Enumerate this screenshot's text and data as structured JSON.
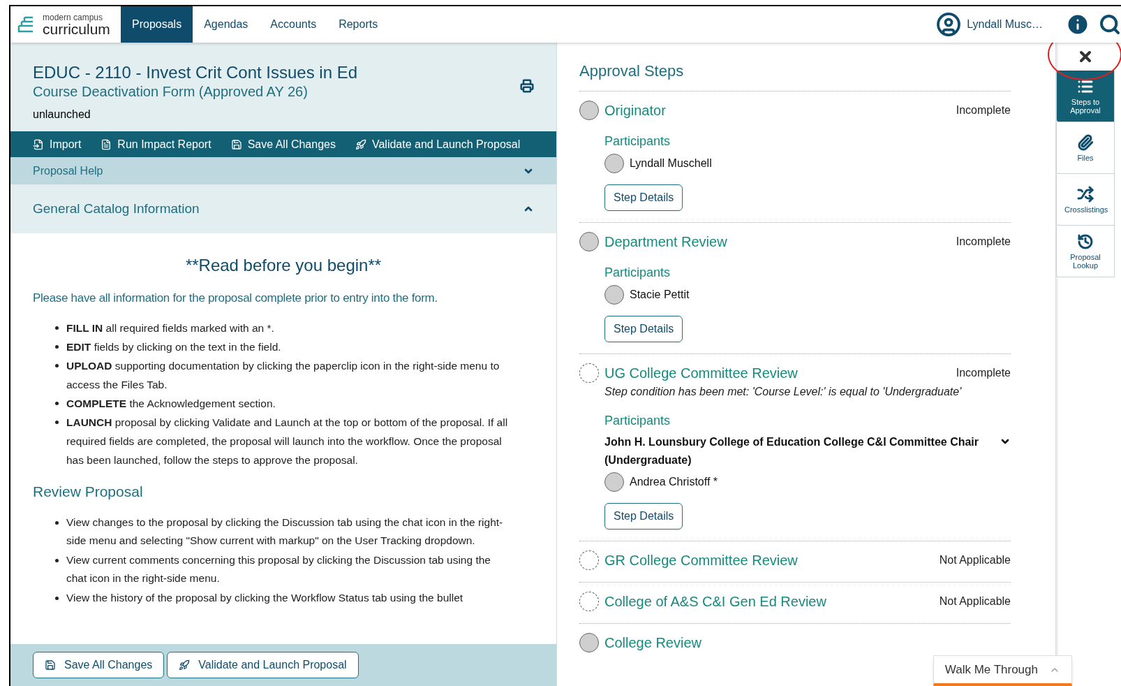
{
  "nav": {
    "logo_top": "modern campus",
    "logo_bottom": "curriculum",
    "tabs": [
      {
        "label": "Proposals",
        "selected": true
      },
      {
        "label": "Agendas",
        "selected": false
      },
      {
        "label": "Accounts",
        "selected": false
      },
      {
        "label": "Reports",
        "selected": false
      }
    ],
    "user": "Lyndall Musc…"
  },
  "proposal": {
    "title": "EDUC - 2110 - Invest Crit Cont Issues in Ed",
    "form": "Course Deactivation Form (Approved AY 26)",
    "status": "unlaunched"
  },
  "toolbar": [
    {
      "kind": "import",
      "label": "Import"
    },
    {
      "kind": "report",
      "label": "Run Impact Report"
    },
    {
      "kind": "save",
      "label": "Save All Changes"
    },
    {
      "kind": "launch",
      "label": "Validate and Launch Proposal"
    }
  ],
  "sections": [
    {
      "kind": "help",
      "label": "Proposal Help",
      "expanded": false
    },
    {
      "kind": "catalog",
      "label": "General Catalog Information",
      "expanded": true
    }
  ],
  "content": {
    "heading": "**Read before you begin**",
    "intro": "Please have all information for the proposal complete prior to entry into the form.",
    "bullets": [
      {
        "lead": "FILL IN",
        "text": "all required fields marked with an *."
      },
      {
        "lead": "EDIT",
        "text": "fields by clicking on the text in the field."
      },
      {
        "lead": "UPLOAD",
        "text": "supporting documentation by clicking the paperclip icon in the right-side menu to access the Files Tab."
      },
      {
        "lead": "COMPLETE",
        "text": "the Acknowledgement section."
      },
      {
        "lead": "LAUNCH",
        "text": "proposal by clicking Validate and Launch at the top or bottom of the proposal.  If all required fields are completed, the proposal will launch into the workflow. Once the proposal has been launched, follow the steps to approve the proposal."
      }
    ],
    "subheading": "Review Proposal",
    "review_bullets": [
      "View changes to the proposal by clicking the Discussion tab using the chat icon in the right-side menu and selecting \"Show current with markup\" on the User Tracking dropdown.",
      "View current comments concerning this proposal by clicking the Discussion tab using the chat icon in the right-side menu.",
      "View the history of the proposal by clicking the Workflow Status tab using the bullet"
    ]
  },
  "bottom_actions": [
    {
      "kind": "save",
      "label": "Save All Changes"
    },
    {
      "kind": "launch",
      "label": "Validate and Launch Proposal"
    }
  ],
  "approval": {
    "title": "Approval Steps",
    "steps": [
      {
        "name": "Originator",
        "status": "Incomplete",
        "kind": "active",
        "participants_label": "Participants",
        "people": [
          "Lyndall Muschell"
        ],
        "details": "Step Details"
      },
      {
        "name": "Department Review",
        "status": "Incomplete",
        "kind": "active",
        "participants_label": "Participants",
        "people": [
          "Stacie Pettit"
        ],
        "details": "Step Details"
      },
      {
        "name": "UG College Committee Review",
        "status": "Incomplete",
        "kind": "conditional",
        "condition": "Step condition has been met: 'Course Level:' is equal to 'Undergraduate'",
        "participants_label": "Participants",
        "role": "John H. Lounsbury College of Education College C&I Committee Chair (Undergraduate)",
        "people": [
          "Andrea Christoff *"
        ],
        "details": "Step Details"
      },
      {
        "name": "GR College Committee Review",
        "status": "Not Applicable",
        "kind": "conditional"
      },
      {
        "name": "College of A&S C&I Gen Ed Review",
        "status": "Not Applicable",
        "kind": "conditional"
      },
      {
        "name": "College Review",
        "kind": "active"
      }
    ]
  },
  "rail": [
    {
      "kind": "close",
      "selected": false
    },
    {
      "kind": "steps",
      "label": "Steps to Approval",
      "selected": true
    },
    {
      "kind": "files",
      "label": "Files",
      "selected": false
    },
    {
      "kind": "cross",
      "label": "Crosslistings",
      "selected": false
    },
    {
      "kind": "lookup",
      "label": "Proposal Lookup",
      "selected": false
    }
  ],
  "walkme": {
    "label": "Walk Me Through"
  }
}
